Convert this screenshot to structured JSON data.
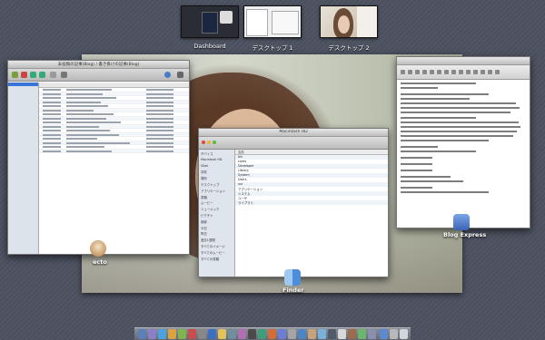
{
  "spaces": [
    {
      "label": "Dashboard"
    },
    {
      "label": "デスクトップ 1"
    },
    {
      "label": "デスクトップ 2"
    }
  ],
  "apps": {
    "ecto": "ecto",
    "finder": "Finder",
    "blog_express": "Blog Express"
  },
  "windows": {
    "left_title": "未投稿の記事(Blog) / 書き掛けの記事(Blog)",
    "finder_title": "Macintosh HD",
    "finder_sidebar": [
      "デバイス",
      "Macintosh HD",
      "iDisk",
      "共有",
      "場所",
      "デスクトップ",
      "アプリケーション",
      "書類",
      "ムービー",
      "ミュージック",
      "ピクチャ",
      "検索",
      "今日",
      "昨日",
      "過去1週間",
      "すべてのイメージ",
      "すべてのムービー",
      "すべての書類"
    ],
    "finder_header": "名前",
    "finder_rows": [
      "bin",
      "cores",
      "Developer",
      "Library",
      "System",
      "Users",
      "usr",
      "アプリケーション",
      "システム",
      "ユーザ",
      "ライブラリ"
    ],
    "colors": {
      "accent_blue": "#3875d7",
      "desktop_bg": "#4d5260"
    }
  }
}
